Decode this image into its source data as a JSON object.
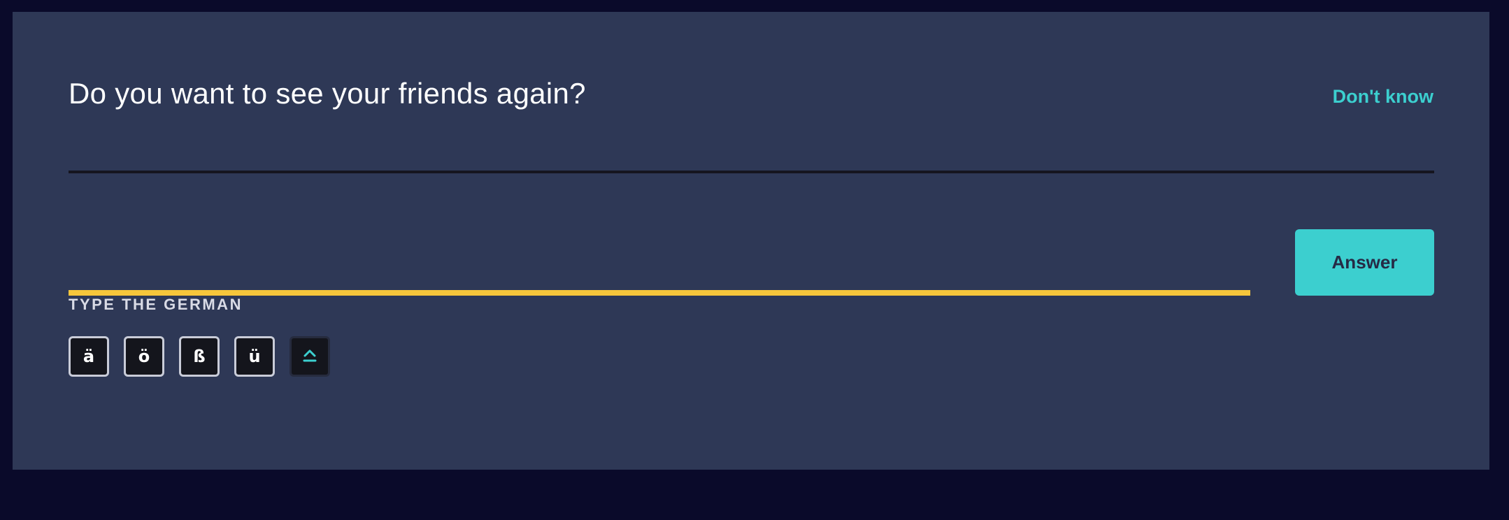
{
  "question": {
    "prompt": "Do you want to see your friends again?",
    "dont_know_label": "Don't know"
  },
  "answer": {
    "value": "",
    "placeholder": "",
    "button_label": "Answer",
    "hint": "TYPE THE GERMAN"
  },
  "special_keys": [
    "ä",
    "ö",
    "ß",
    "ü"
  ],
  "shift_key": {
    "icon": "caps-shift-icon"
  },
  "colors": {
    "page_background": "#0a0a2a",
    "card_background": "#2e3856",
    "accent": "#3ccfcf",
    "input_underline": "#f6c63b"
  }
}
